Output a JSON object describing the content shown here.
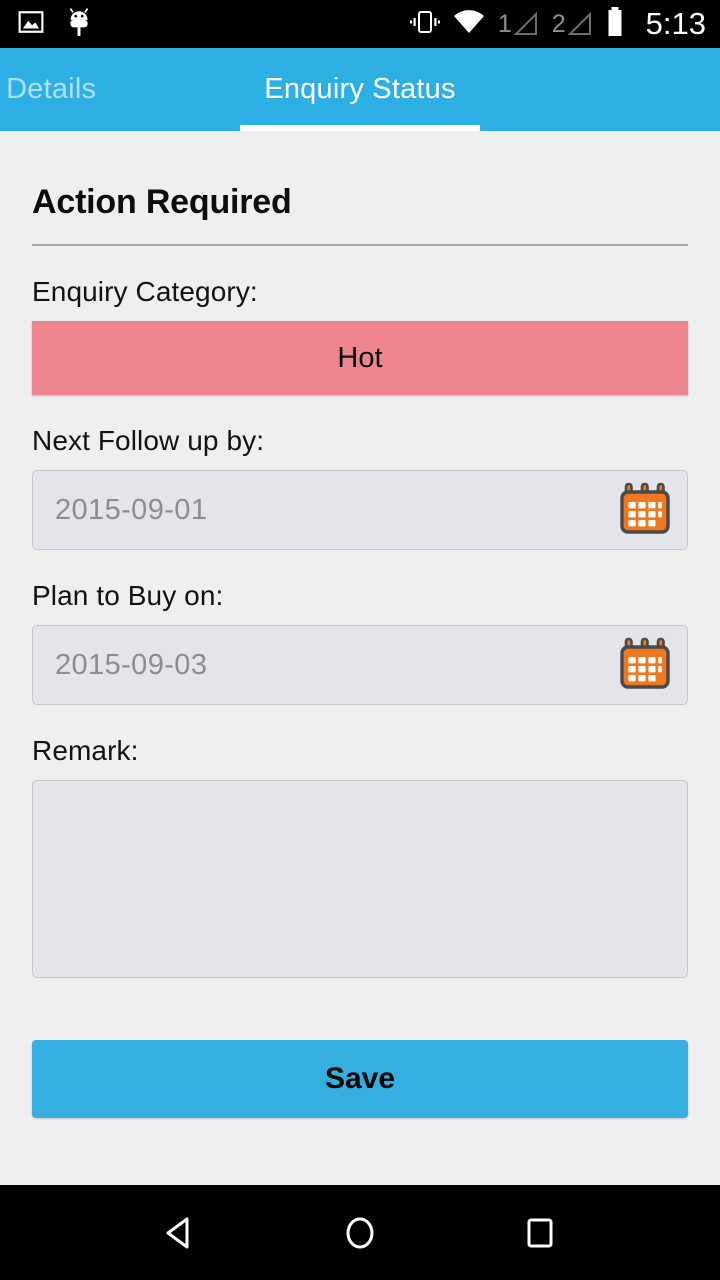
{
  "status_bar": {
    "icons_left": [
      "image-icon",
      "android-debug-icon"
    ],
    "icons_right": [
      "vibrate-icon",
      "wifi-icon",
      "sim1-signal-icon",
      "sim2-signal-icon",
      "battery-icon"
    ],
    "sim1_label": "1",
    "sim2_label": "2",
    "clock": "5:13"
  },
  "tabs": [
    {
      "label": "quiry Details",
      "active": false
    },
    {
      "label": "Enquiry Status",
      "active": true
    }
  ],
  "form": {
    "section_title": "Action Required",
    "category": {
      "label": "Enquiry Category:",
      "value": "Hot",
      "color": "#ef858f"
    },
    "next_follow_up": {
      "label": "Next Follow up by:",
      "value": "2015-09-01",
      "icon": "calendar-icon"
    },
    "plan_to_buy": {
      "label": "Plan to Buy on:",
      "value": "2015-09-03",
      "icon": "calendar-icon"
    },
    "remark": {
      "label": "Remark:",
      "value": "",
      "placeholder": ""
    },
    "save_label": "Save"
  },
  "nav_bar": {
    "back": "back-icon",
    "home": "home-icon",
    "recents": "recents-icon"
  },
  "colors": {
    "accent_blue": "#2EAFE4",
    "save_blue": "#36AEE0",
    "category_pink": "#ef858f",
    "calendar_orange": "#F07820",
    "page_bg": "#efefef"
  }
}
